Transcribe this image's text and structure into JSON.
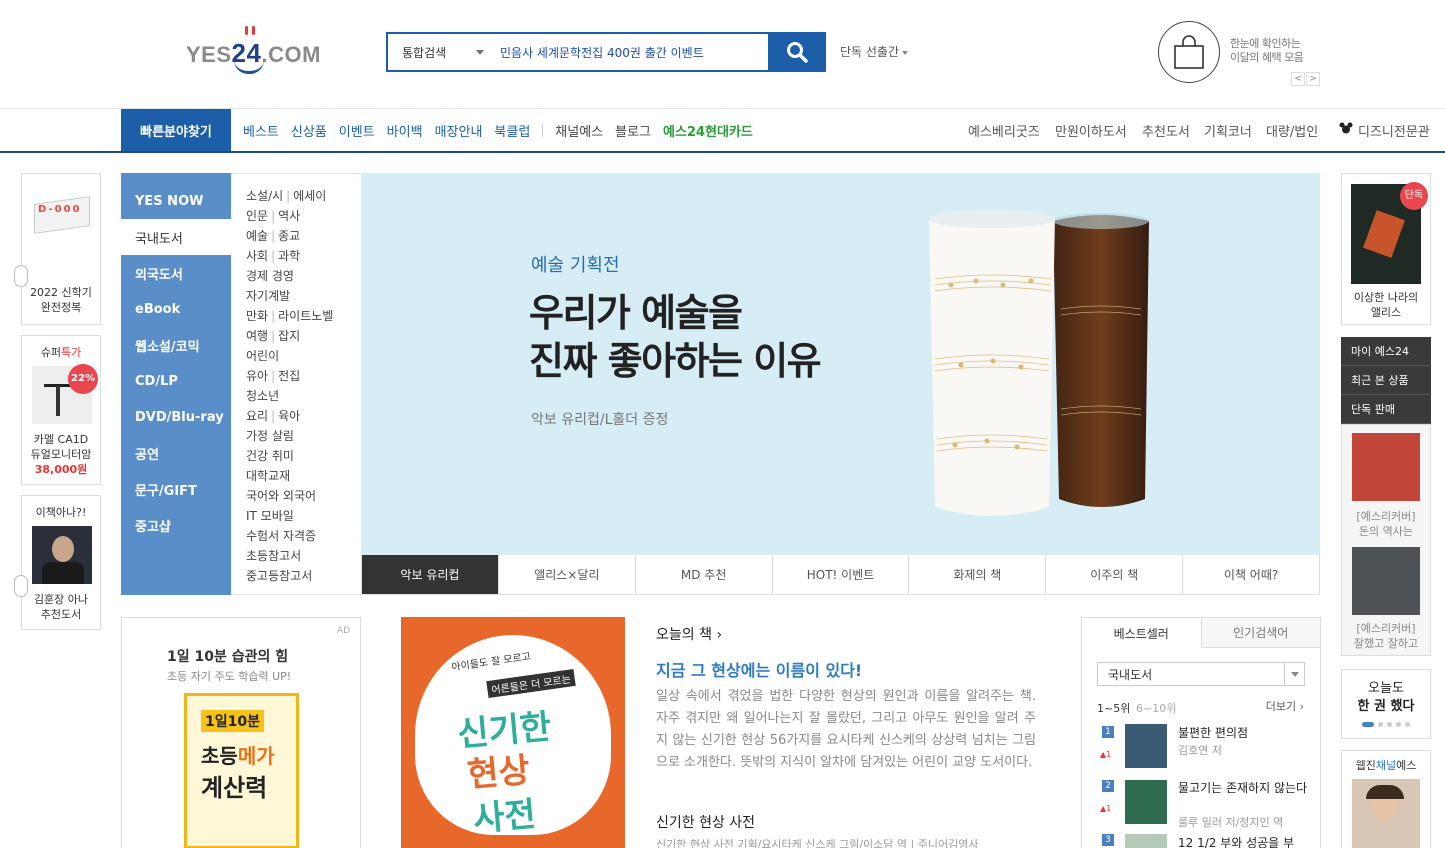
{
  "header": {
    "logo_text": "YES24.COM",
    "search_category": "통합검색",
    "search_query": "민음사 세계문학전집 400권 출간 이벤트",
    "exclusive_label": "단독 선출간",
    "benefit_line1": "한눈에 확인하는",
    "benefit_line2": "이달의 혜택 모음",
    "prev": "<",
    "next": ">"
  },
  "nav": {
    "quick_find": "빠른분야찾기",
    "left_items": [
      "베스트",
      "신상품",
      "이벤트",
      "바이백",
      "매장안내",
      "북클럽"
    ],
    "left_items2": [
      "채널예스",
      "블로그",
      "예스24현대카드"
    ],
    "right_items": [
      "예스베리굿즈",
      "만원이하도서",
      "추천도서",
      "기획코너",
      "대량/법인",
      "디즈니전문관"
    ]
  },
  "left_sidebar": {
    "calendar_text": "D-000",
    "item1_line1": "2022 신학기",
    "item1_line2": "완전정복",
    "item2_title_a": "슈퍼",
    "item2_title_b": "특가",
    "item2_badge": "22%",
    "item2_line1": "카멜 CA1D",
    "item2_line2": "듀얼모니터암",
    "item2_price": "38,000원",
    "item3_title": "이책아나?!",
    "item3_line1": "김훈장 아나",
    "item3_line2": "추천도서"
  },
  "categories": [
    "YES NOW",
    "국내도서",
    "외국도서",
    "eBook",
    "웹소설/코믹",
    "CD/LP",
    "DVD/Blu-ray",
    "공연",
    "문구/GIFT",
    "중고샵"
  ],
  "subcategories": [
    [
      "소설/시",
      "에세이"
    ],
    [
      "인문",
      "역사"
    ],
    [
      "예술",
      "종교"
    ],
    [
      "사회",
      "과학"
    ],
    [
      "경제 경영"
    ],
    [
      "자기계발"
    ],
    [
      "만화",
      "라이트노벨"
    ],
    [
      "여행",
      "잡지"
    ],
    [
      "어린이"
    ],
    [
      "유아",
      "전집"
    ],
    [
      "청소년"
    ],
    [
      "요리",
      "육아"
    ],
    [
      "가정 살림"
    ],
    [
      "건강 취미"
    ],
    [
      "대학교재"
    ],
    [
      "국어와 외국어"
    ],
    [
      "IT 모바일"
    ],
    [
      "수험서 자격증"
    ],
    [
      "초등참고서"
    ],
    [
      "중고등참고서"
    ]
  ],
  "banner": {
    "eyebrow": "예술 기획전",
    "title_line1": "우리가 예술을",
    "title_line2": "진짜 좋아하는 이유",
    "subtitle": "악보 유리컵/L홀더 증정"
  },
  "banner_tabs": [
    "악보 유리컵",
    "앨리스×달리",
    "MD 추천",
    "HOT! 이벤트",
    "화제의 책",
    "이주의 책",
    "이책 어때?"
  ],
  "ad": {
    "tag": "AD",
    "title": "1일 10분 습관의 힘",
    "subtitle": "초등 자기 주도 학습력 UP!",
    "cover_line1": "1일10분",
    "cover_line2a": "초등",
    "cover_line2b": "메가",
    "cover_line3": "계산력"
  },
  "today_book": {
    "section_label": "오늘의 책",
    "headline": "지금 그 현상에는 이름이 있다!",
    "desc": "일상 속에서 겪었을 법한 다양한 현상의 원인과 이름을 알려주는 책. 자주 겪지만 왜 일어나는지 잘 몰랐던, 그리고 아무도 원인을 알려 주지 않는 신기한 현상 56가지를 요시타케 신스케의 상상력 넘치는 그림으로 소개한다. 뜻밖의 지식이 알차에 담겨있는 어린이 교양 도서이다.",
    "book_title": "신기한 현상 사전",
    "book_meta": "신기한 현상 사전 기획/요시타케 신스케 그림/이소담 역 | 주니어김영사",
    "cover_tag1": "아이들도 잘 모르고",
    "cover_tag2": "어른들은 더 모르는",
    "cover_title1": "신기한",
    "cover_title2": "현상",
    "cover_title3": "사전"
  },
  "bestseller": {
    "tab1": "베스트셀러",
    "tab2": "인기검색어",
    "select": "국내도서",
    "range1": "1~5위",
    "range2": "6~10위",
    "more": "더보기",
    "items": [
      {
        "rank": "1",
        "title": "불편한 편의점",
        "author": "김호연 저",
        "change": "▲1"
      },
      {
        "rank": "2",
        "title": "물고기는 존재하지 않는다",
        "author": "룰루 밀러 저/정지인 역",
        "change": "▲1"
      },
      {
        "rank": "3",
        "title": "12 1/2 부와 성공을 부",
        "author": "",
        "change": ""
      }
    ]
  },
  "right_sidebar": {
    "badge": "단독",
    "book1_line1": "이상한 나라의",
    "book1_line2": "앨리스",
    "menu": [
      "마이 예스24",
      "최근 본 상품",
      "단독 판매"
    ],
    "rec1_line1": "[예스리커버]",
    "rec1_line2": "돈의 역사는",
    "rec2_line1": "[예스리커버]",
    "rec2_line2": "잘했고 잘하고",
    "today_line1": "오늘도",
    "today_line2": "한 권 했다",
    "channel_a": "웹진",
    "channel_b": "채널",
    "channel_c": "예스"
  }
}
